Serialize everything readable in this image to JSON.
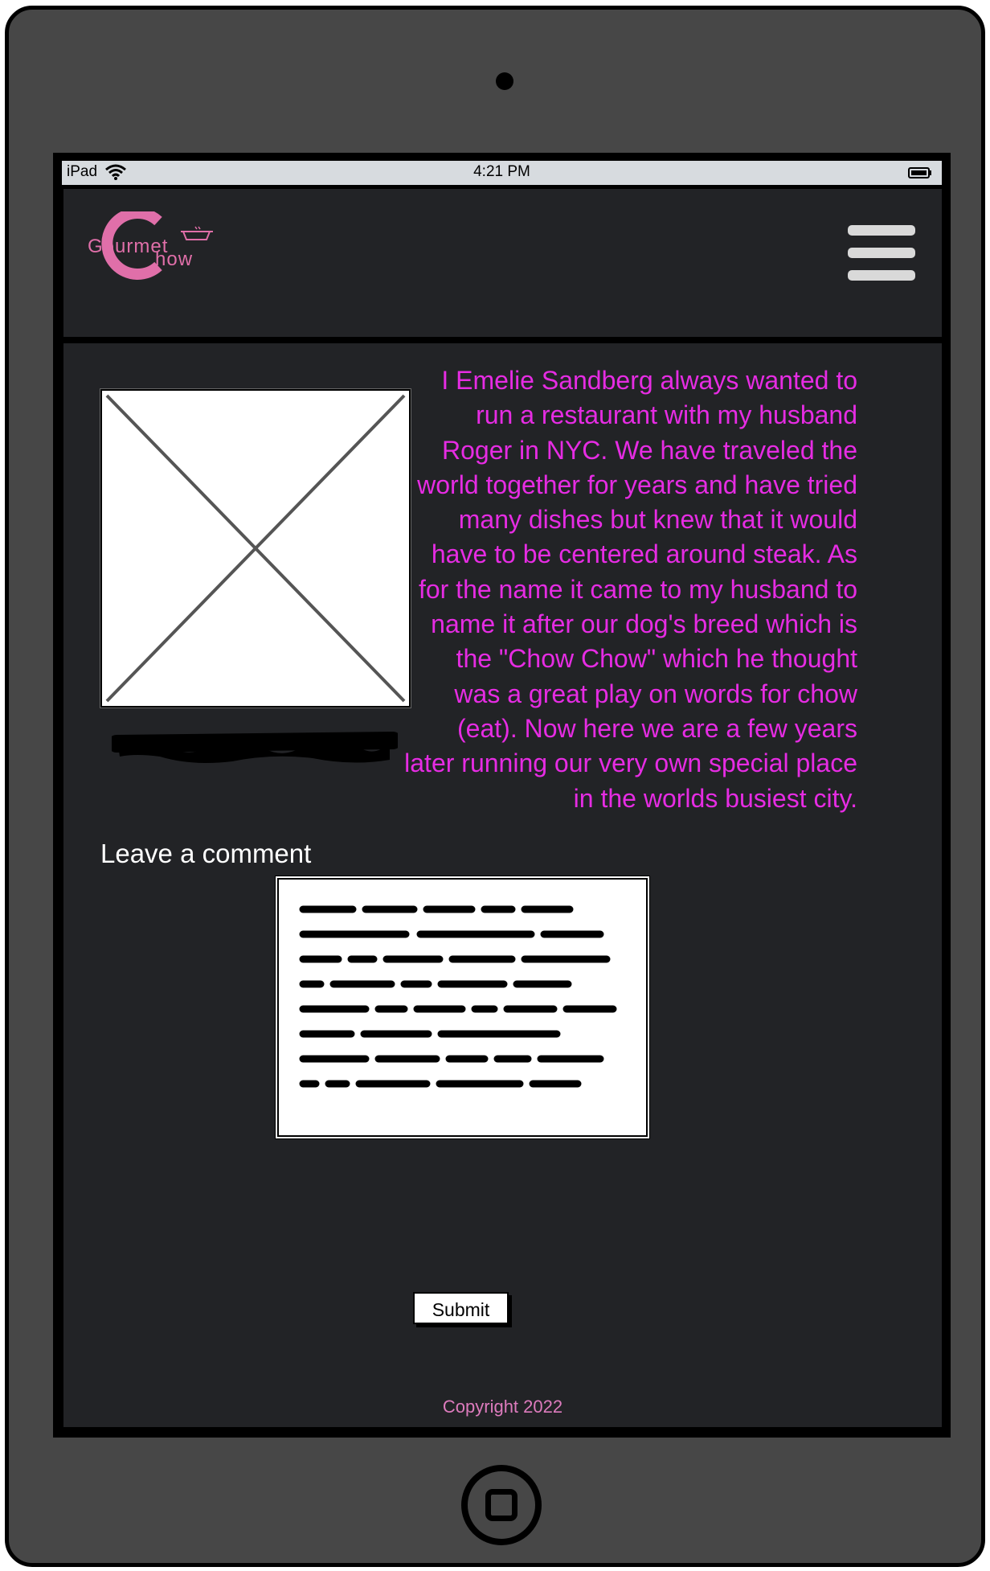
{
  "status_bar": {
    "device": "iPad",
    "time": "4:21 PM"
  },
  "header": {
    "logo": {
      "word1": "Gourmet",
      "word2_initial": "C",
      "word2_rest": "how",
      "accent_color": "#e06fa9"
    },
    "menu_icon": "hamburger-menu-icon"
  },
  "about": {
    "image_placeholder": "image-placeholder",
    "bio": "I Emelie Sandberg always wanted to run a restaurant with my husband Roger in NYC. We have traveled the world together for years and have tried many dishes but knew that it would have to be centered around steak. As for the name it came to my husband to name it after our dog's breed which is the \"Chow Chow\" which he thought was a great play on words for chow (eat). Now here we are a few years later running our very own special place in the worlds busiest city.",
    "bio_color": "#e62ce3"
  },
  "comments": {
    "heading": "Leave a comment",
    "submit_label": "Submit"
  },
  "footer": {
    "copyright": "Copyright 2022",
    "color": "#dd7bbd"
  }
}
